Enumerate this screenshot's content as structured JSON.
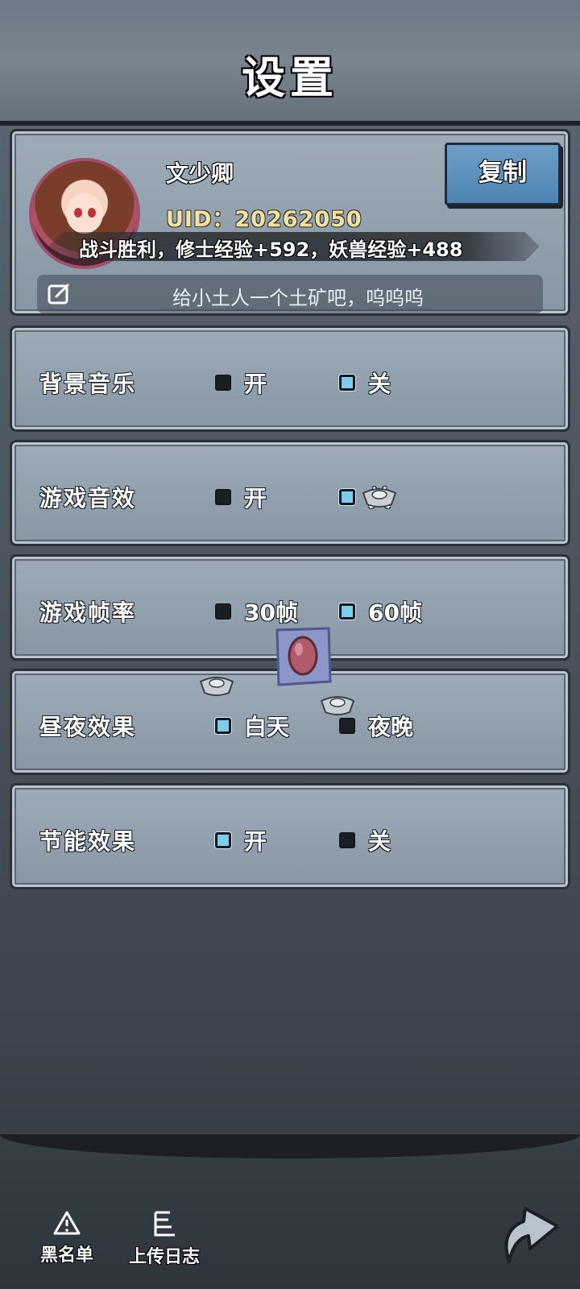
{
  "header": {
    "title": "设置"
  },
  "profile": {
    "name": "文少卿",
    "uid": "UID：20262050",
    "copy_label": "复制",
    "battle_message": "战斗胜利，修士经验+592，妖兽经验+488",
    "signature": "给小土人一个土矿吧，呜呜呜"
  },
  "settings": [
    {
      "label": "背景音乐",
      "option1": "开",
      "option2": "关",
      "selected": 2
    },
    {
      "label": "游戏音效",
      "option1": "开",
      "option2": "关",
      "selected": 2
    },
    {
      "label": "游戏帧率",
      "option1": "30帧",
      "option2": "60帧",
      "selected": 2
    },
    {
      "label": "昼夜效果",
      "option1": "白天",
      "option2": "夜晚",
      "selected": 1
    },
    {
      "label": "节能效果",
      "option1": "开",
      "option2": "关",
      "selected": 1
    }
  ],
  "footer": {
    "blacklist_label": "黑名单",
    "upload_log_label": "上传日志"
  },
  "colors": {
    "selected_box": "#7ecbea",
    "copy_button": "#5a8fbf",
    "uid_text": "#f0e3a8"
  },
  "icons": [
    "edit-icon",
    "warning-icon",
    "log-icon",
    "back-arrow-icon",
    "silver-ingot-icon",
    "gem-scroll-icon"
  ]
}
